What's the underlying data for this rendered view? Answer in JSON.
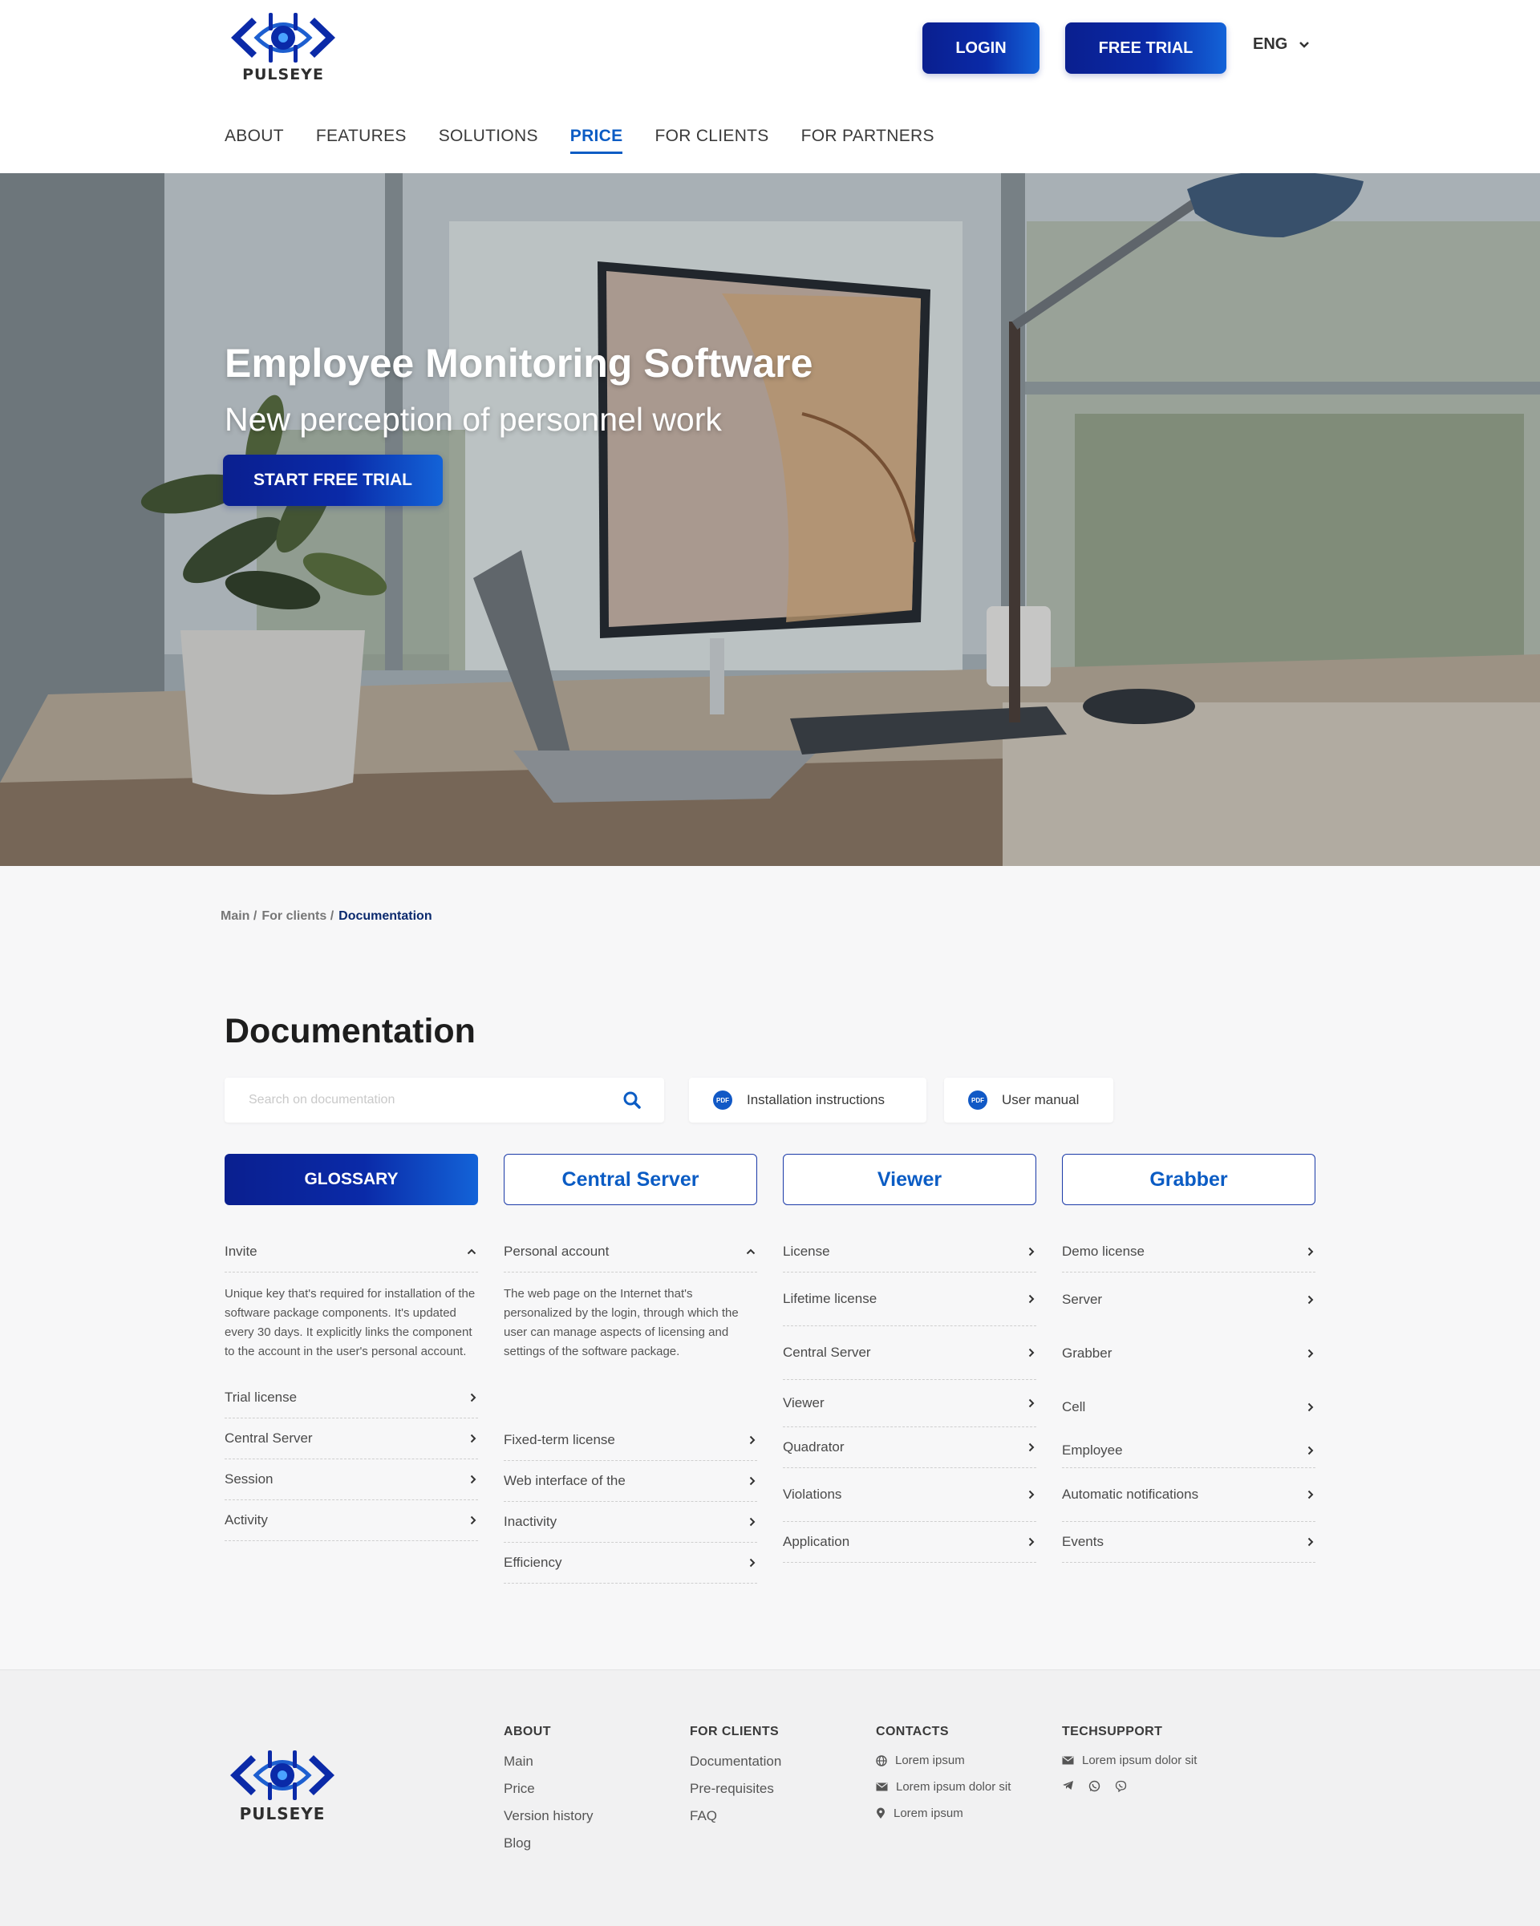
{
  "brand": {
    "name": "PULSEYE",
    "accent": "#0b5cc4",
    "dark": "#0a1f8f"
  },
  "header": {
    "login_label": "LOGIN",
    "trial_label": "FREE TRIAL",
    "language": "ENG",
    "nav": [
      {
        "label": "ABOUT"
      },
      {
        "label": "FEATURES"
      },
      {
        "label": "SOLUTIONS"
      },
      {
        "label": "PRICE",
        "active": true
      },
      {
        "label": "FOR CLIENTS"
      },
      {
        "label": "FOR PARTNERS"
      }
    ]
  },
  "hero": {
    "title": "Employee Monitoring Software",
    "subtitle": "New perception of personnel work",
    "cta": "START FREE TRIAL"
  },
  "breadcrumb": {
    "main": "Main /",
    "clients": "For clients /",
    "current": "Documentation"
  },
  "docs": {
    "title": "Documentation",
    "search_placeholder": "Search on documentation",
    "install_label": "Installation instructions",
    "manual_label": "User manual",
    "tabs": [
      {
        "label": "GLOSSARY",
        "active": true
      },
      {
        "label": "Central Server"
      },
      {
        "label": "Viewer"
      },
      {
        "label": "Grabber"
      }
    ],
    "columns": [
      {
        "items": [
          {
            "label": "Invite",
            "expanded": true,
            "description": "Unique key that's required for installation of the software package components. It's updated every 30 days. It explicitly links the component to the account in the user's personal account."
          },
          {
            "label": "Trial license"
          },
          {
            "label": "Central Server"
          },
          {
            "label": "Session"
          },
          {
            "label": "Activity"
          }
        ]
      },
      {
        "items": [
          {
            "label": "Personal account",
            "expanded": true,
            "description": "The web page on the Internet that's personalized by the login, through which the user can manage aspects of licensing and settings of the software package."
          },
          {
            "label": "Fixed-term license"
          },
          {
            "label": "Web interface of the"
          },
          {
            "label": "Inactivity"
          },
          {
            "label": "Efficiency"
          }
        ]
      },
      {
        "items": [
          {
            "label": "License"
          },
          {
            "label": "Lifetime license"
          },
          {
            "label": "Central Server"
          },
          {
            "label": "Viewer"
          },
          {
            "label": "Quadrator"
          },
          {
            "label": "Violations"
          },
          {
            "label": "Application"
          }
        ]
      },
      {
        "items": [
          {
            "label": "Demo license"
          },
          {
            "label": "Server"
          },
          {
            "label": "Grabber"
          },
          {
            "label": "Cell"
          },
          {
            "label": "Employee"
          },
          {
            "label": "Automatic notifications"
          },
          {
            "label": "Events"
          }
        ]
      }
    ]
  },
  "footer": {
    "about": {
      "heading": "ABOUT",
      "links": [
        "Main",
        "Price",
        "Version history",
        "Blog"
      ]
    },
    "clients": {
      "heading": "FOR CLIENTS",
      "links": [
        "Documentation",
        "Pre-requisites",
        "FAQ"
      ]
    },
    "contacts": {
      "heading": "CONTACTS",
      "lines": [
        {
          "icon": "globe-icon",
          "text": "Lorem ipsum"
        },
        {
          "icon": "mail-icon",
          "text": "Lorem ipsum dolor sit"
        },
        {
          "icon": "location-pin-icon",
          "text": "Lorem ipsum"
        }
      ]
    },
    "techsupport": {
      "heading": "TECHSUPPORT",
      "email": "Lorem ipsum dolor sit",
      "social": [
        "telegram-icon",
        "whatsapp-icon",
        "viber-icon"
      ]
    }
  }
}
